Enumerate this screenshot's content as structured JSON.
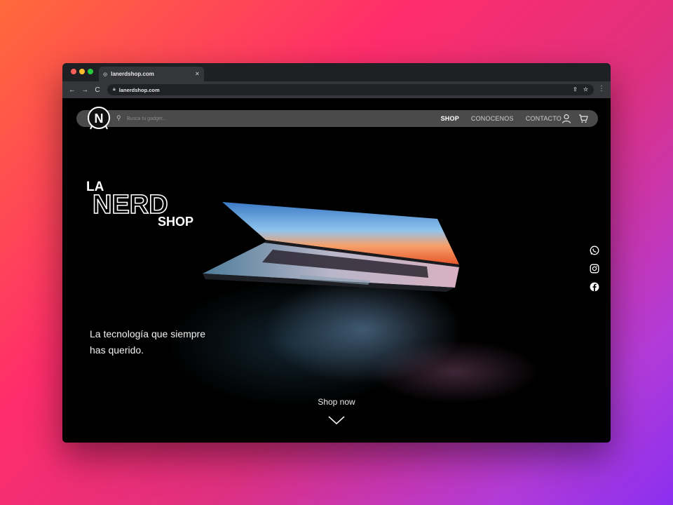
{
  "browser": {
    "tab_title": "lanerdshop.com",
    "tab_close": "×",
    "url": "lanerdshop.com",
    "back": "←",
    "forward": "→",
    "reload": "C",
    "share": "⇧",
    "bookmark": "☆",
    "menu": "⋮"
  },
  "header": {
    "logo_letter": "N",
    "search_placeholder": "Busca tu gadget...",
    "nav": [
      {
        "label": "SHOP",
        "active": true
      },
      {
        "label": "CONOCENOS",
        "active": false
      },
      {
        "label": "CONTACTO",
        "active": false
      }
    ]
  },
  "hero": {
    "brand": {
      "top": "LA",
      "middle": "NERD",
      "bottom": "SHOP"
    },
    "tagline_line1": "La tecnología que siempre",
    "tagline_line2": "has querido.",
    "cta": "Shop now"
  },
  "socials": [
    {
      "icon": "whatsapp-icon"
    },
    {
      "icon": "instagram-icon"
    },
    {
      "icon": "facebook-icon"
    }
  ],
  "colors": {
    "background_start": "#ff6a3a",
    "background_end": "#8b2ff0",
    "nav_bar": "#4a4a4a",
    "page_bg": "#000000"
  }
}
